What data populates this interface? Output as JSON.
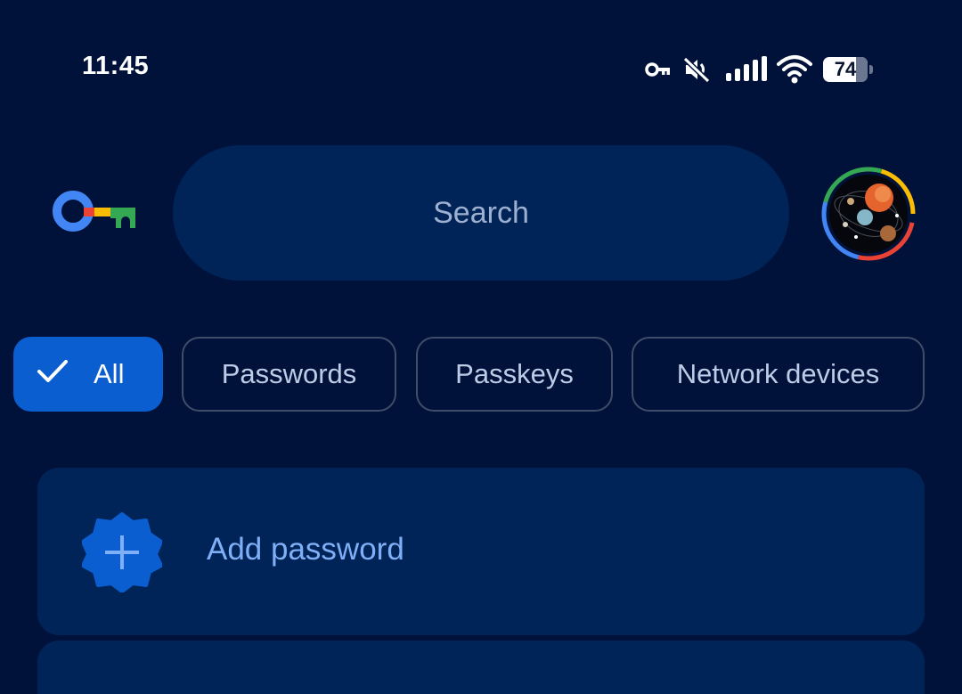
{
  "status_bar": {
    "time": "11:45",
    "battery_level": "74",
    "icons": [
      "vpn-key-icon",
      "mute-icon",
      "signal-icon",
      "wifi-icon",
      "battery-icon"
    ]
  },
  "header": {
    "logo_icon": "password-manager-key-logo",
    "search_placeholder": "Search",
    "avatar_icon": "account-avatar"
  },
  "filters": [
    {
      "label": "All",
      "selected": true
    },
    {
      "label": "Passwords",
      "selected": false
    },
    {
      "label": "Passkeys",
      "selected": false
    },
    {
      "label": "Network devices",
      "selected": false
    }
  ],
  "add_item": {
    "label": "Add password",
    "icon": "add-badge-icon"
  },
  "colors": {
    "background": "#00123a",
    "surface": "#012458",
    "accent": "#0b5ecf",
    "link_text": "#7fb0f7"
  }
}
